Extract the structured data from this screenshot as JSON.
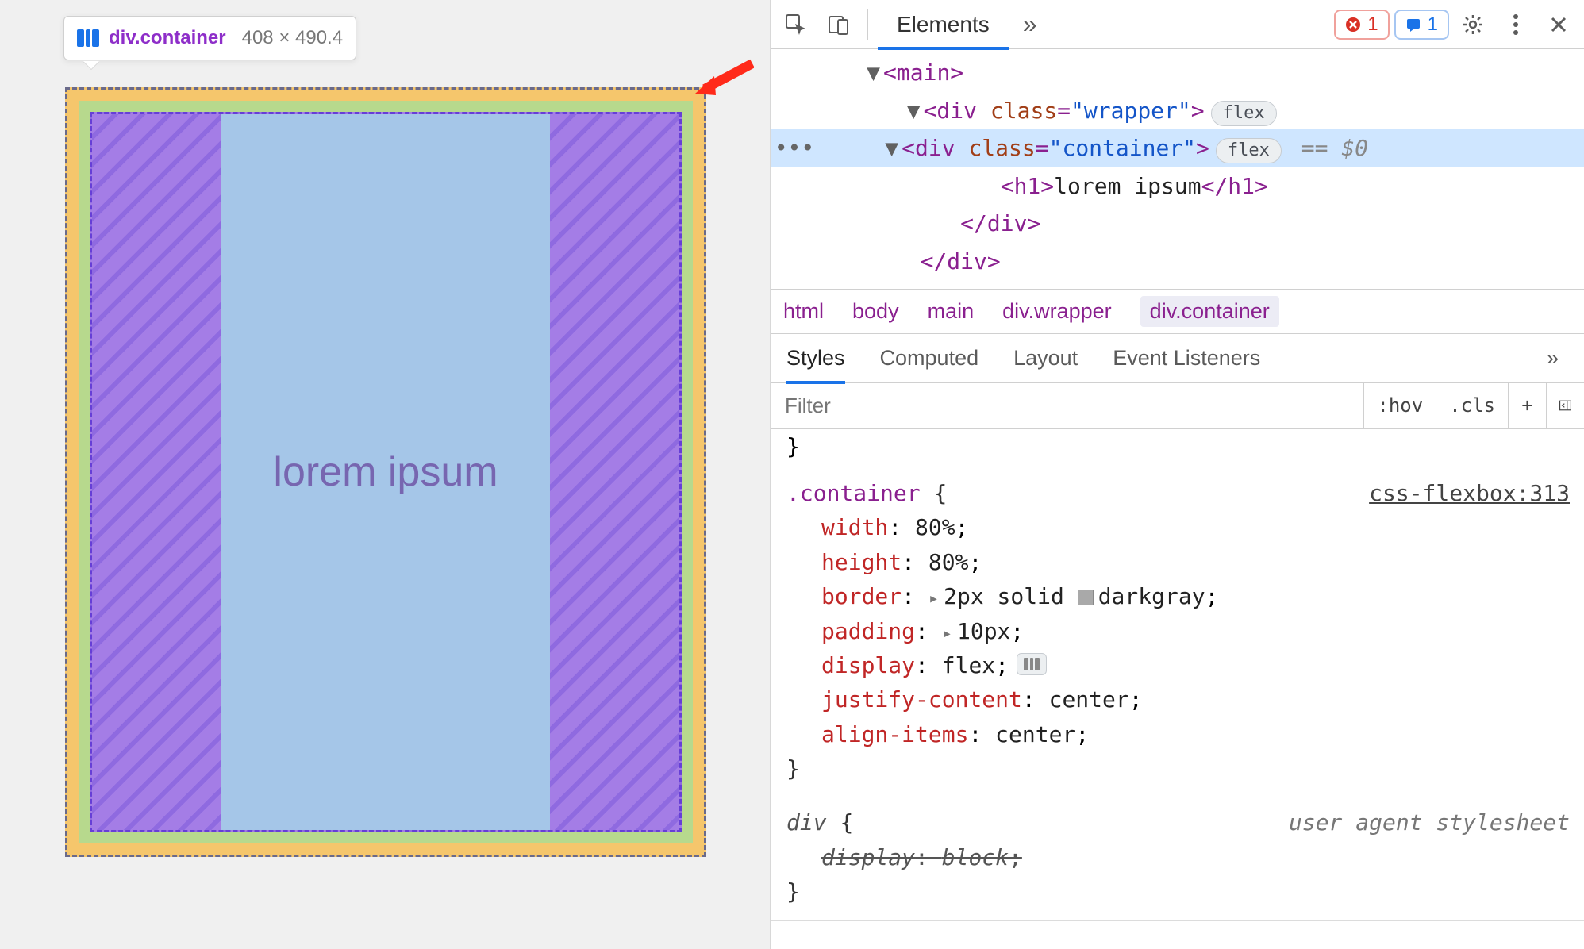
{
  "viewport": {
    "tooltip_selector_tag": "div",
    "tooltip_selector_class": ".container",
    "tooltip_dims": "408 × 490.4",
    "content_text": "lorem ipsum"
  },
  "toolbar": {
    "tab_elements": "Elements",
    "errors_count": "1",
    "messages_count": "1"
  },
  "dom": {
    "l0": "<main>",
    "l1_open": "<div ",
    "l1_attr": "class",
    "l1_val": "\"wrapper\"",
    "l1_close": ">",
    "l1_chip": "flex",
    "sel_open": "<div ",
    "sel_attr": "class",
    "sel_val": "\"container\"",
    "sel_close": ">",
    "sel_chip": "flex",
    "sel_var": "== $0",
    "h1_open": "<h1>",
    "h1_text": "lorem ipsum",
    "h1_close": "</h1>",
    "divclose": "</div>",
    "divclose2": "</div>"
  },
  "crumbs": [
    "html",
    "body",
    "main",
    "div.wrapper",
    "div.container"
  ],
  "sp_tabs": [
    "Styles",
    "Computed",
    "Layout",
    "Event Listeners"
  ],
  "filter_placeholder": "Filter",
  "fr": {
    "hov": ":hov",
    "cls": ".cls"
  },
  "rule1": {
    "selector": ".container",
    "src": "css-flexbox:313",
    "props": [
      {
        "n": "width",
        "v": "80%"
      },
      {
        "n": "height",
        "v": "80%"
      },
      {
        "n": "border",
        "v": "2px solid ",
        "swatch": true,
        "after": "darkgray",
        "expand": true
      },
      {
        "n": "padding",
        "v": "10px",
        "expand": true
      },
      {
        "n": "display",
        "v": "flex",
        "flexmini": true
      },
      {
        "n": "justify-content",
        "v": "center"
      },
      {
        "n": "align-items",
        "v": "center"
      }
    ]
  },
  "rule2": {
    "selector": "div",
    "src": "user agent stylesheet",
    "props": [
      {
        "n": "display",
        "v": "block",
        "strike": true
      }
    ]
  }
}
